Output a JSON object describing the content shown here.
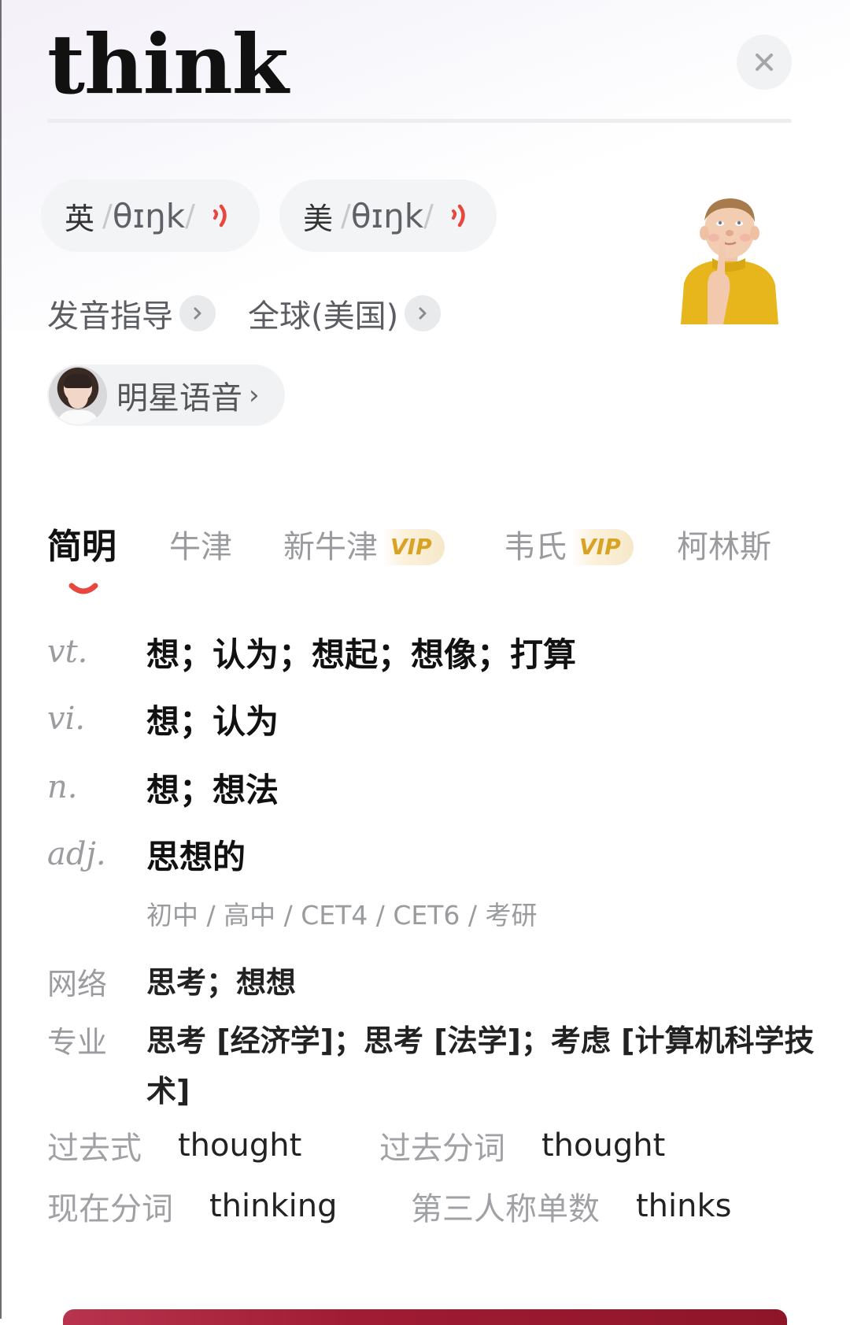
{
  "header": {
    "word": "think",
    "close_icon": "close-icon"
  },
  "pronunciation": {
    "uk": {
      "region": "英",
      "ipa": "θɪŋk",
      "slash": "/",
      "icon": "speaker-icon"
    },
    "us": {
      "region": "美",
      "ipa": "θɪŋk",
      "slash": "/",
      "icon": "speaker-icon"
    },
    "guide_label": "发音指导",
    "accent_label": "全球(美国)",
    "chevron": "›",
    "celebrity_label": "明星语音",
    "accent_color": "#e8473e"
  },
  "image": {
    "alt": "thinking-boy"
  },
  "tabs": [
    {
      "label": "简明",
      "active": true
    },
    {
      "label": "牛津",
      "active": false
    },
    {
      "label": "新牛津",
      "active": false,
      "badge": "VIP"
    },
    {
      "label": "韦氏",
      "active": false,
      "badge": "VIP"
    },
    {
      "label": "柯林斯",
      "active": false
    }
  ],
  "definitions": [
    {
      "pos": "vt.",
      "meaning": "想；认为；想起；想像；打算"
    },
    {
      "pos": "vi.",
      "meaning": "想；认为"
    },
    {
      "pos": "n.",
      "meaning": "想；想法"
    },
    {
      "pos": "adj.",
      "meaning": "思想的"
    }
  ],
  "exam_tags": "初中 / 高中 / CET4 / CET6 / 考研",
  "extras": [
    {
      "label": "网络",
      "value": "思考；想想"
    },
    {
      "label": "专业",
      "value": "思考 [经济学]；思考 [法学]；考虑 [计算机科学技术]"
    }
  ],
  "forms": [
    {
      "label": "过去式",
      "value": "thought"
    },
    {
      "label": "过去分词",
      "value": "thought"
    },
    {
      "label": "现在分词",
      "value": "thinking"
    },
    {
      "label": "第三人称单数",
      "value": "thinks"
    }
  ],
  "colors": {
    "tab_underline": "#e8473e",
    "vip_text": "#d8a224",
    "bottom_bar": "#a01c34"
  }
}
